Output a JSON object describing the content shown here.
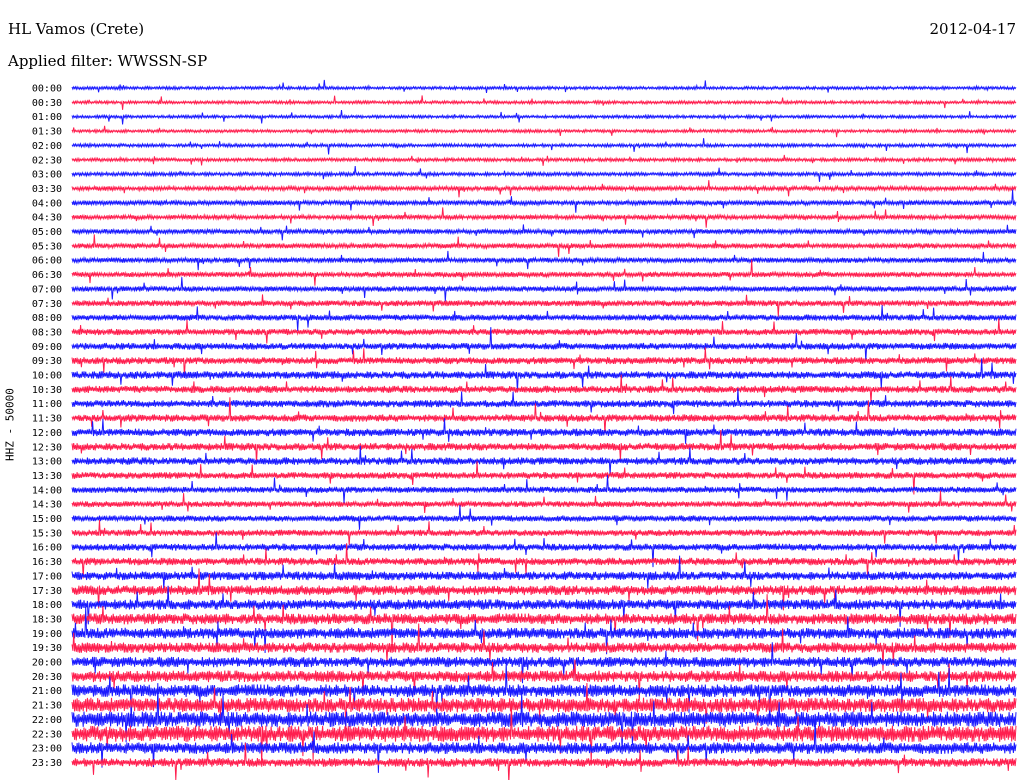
{
  "header": {
    "station": "HL Vamos (Crete)",
    "date": "2012-04-17",
    "filter": "Applied filter: WWSSN-SP"
  },
  "colors": {
    "odd": "#1a1aff",
    "even": "#ff1f4f"
  },
  "chart_data": {
    "type": "line",
    "ylabel": "HHZ - 50000",
    "traces": [
      {
        "label": "00:00",
        "color": "blue",
        "amp": 1
      },
      {
        "label": "00:30",
        "color": "red",
        "amp": 1
      },
      {
        "label": "01:00",
        "color": "blue",
        "amp": 1
      },
      {
        "label": "01:30",
        "color": "red",
        "amp": 1
      },
      {
        "label": "02:00",
        "color": "blue",
        "amp": 1.1
      },
      {
        "label": "02:30",
        "color": "red",
        "amp": 1.1
      },
      {
        "label": "03:00",
        "color": "blue",
        "amp": 1.2
      },
      {
        "label": "03:30",
        "color": "red",
        "amp": 1.5
      },
      {
        "label": "04:00",
        "color": "blue",
        "amp": 1.6
      },
      {
        "label": "04:30",
        "color": "red",
        "amp": 1.5
      },
      {
        "label": "05:00",
        "color": "blue",
        "amp": 1.6
      },
      {
        "label": "05:30",
        "color": "red",
        "amp": 1.7
      },
      {
        "label": "06:00",
        "color": "blue",
        "amp": 1.7
      },
      {
        "label": "06:30",
        "color": "red",
        "amp": 1.8
      },
      {
        "label": "07:00",
        "color": "blue",
        "amp": 1.8
      },
      {
        "label": "07:30",
        "color": "red",
        "amp": 2
      },
      {
        "label": "08:00",
        "color": "blue",
        "amp": 2.1
      },
      {
        "label": "08:30",
        "color": "red",
        "amp": 2.2
      },
      {
        "label": "09:00",
        "color": "blue",
        "amp": 2.3
      },
      {
        "label": "09:30",
        "color": "red",
        "amp": 2.4
      },
      {
        "label": "10:00",
        "color": "blue",
        "amp": 2.6
      },
      {
        "label": "10:30",
        "color": "red",
        "amp": 2.5
      },
      {
        "label": "11:00",
        "color": "blue",
        "amp": 2.5
      },
      {
        "label": "11:30",
        "color": "red",
        "amp": 2.5
      },
      {
        "label": "12:00",
        "color": "blue",
        "amp": 2.6
      },
      {
        "label": "12:30",
        "color": "red",
        "amp": 2.6
      },
      {
        "label": "13:00",
        "color": "blue",
        "amp": 2.6
      },
      {
        "label": "13:30",
        "color": "red",
        "amp": 2.3
      },
      {
        "label": "14:00",
        "color": "blue",
        "amp": 2.1
      },
      {
        "label": "14:30",
        "color": "red",
        "amp": 2
      },
      {
        "label": "15:00",
        "color": "blue",
        "amp": 2.1
      },
      {
        "label": "15:30",
        "color": "red",
        "amp": 2.2
      },
      {
        "label": "16:00",
        "color": "blue",
        "amp": 2.4
      },
      {
        "label": "16:30",
        "color": "red",
        "amp": 2.6
      },
      {
        "label": "17:00",
        "color": "blue",
        "amp": 3
      },
      {
        "label": "17:30",
        "color": "red",
        "amp": 3.4
      },
      {
        "label": "18:00",
        "color": "blue",
        "amp": 3.6
      },
      {
        "label": "18:30",
        "color": "red",
        "amp": 3.8
      },
      {
        "label": "19:00",
        "color": "blue",
        "amp": 3.8
      },
      {
        "label": "19:30",
        "color": "red",
        "amp": 3.6
      },
      {
        "label": "20:00",
        "color": "blue",
        "amp": 3.6
      },
      {
        "label": "20:30",
        "color": "red",
        "amp": 4
      },
      {
        "label": "21:00",
        "color": "blue",
        "amp": 4.4
      },
      {
        "label": "21:30",
        "color": "red",
        "amp": 5
      },
      {
        "label": "22:00",
        "color": "blue",
        "amp": 5.4
      },
      {
        "label": "22:30",
        "color": "red",
        "amp": 5.6
      },
      {
        "label": "23:00",
        "color": "blue",
        "amp": 4
      },
      {
        "label": "23:30",
        "color": "red",
        "amp": 3
      }
    ]
  }
}
